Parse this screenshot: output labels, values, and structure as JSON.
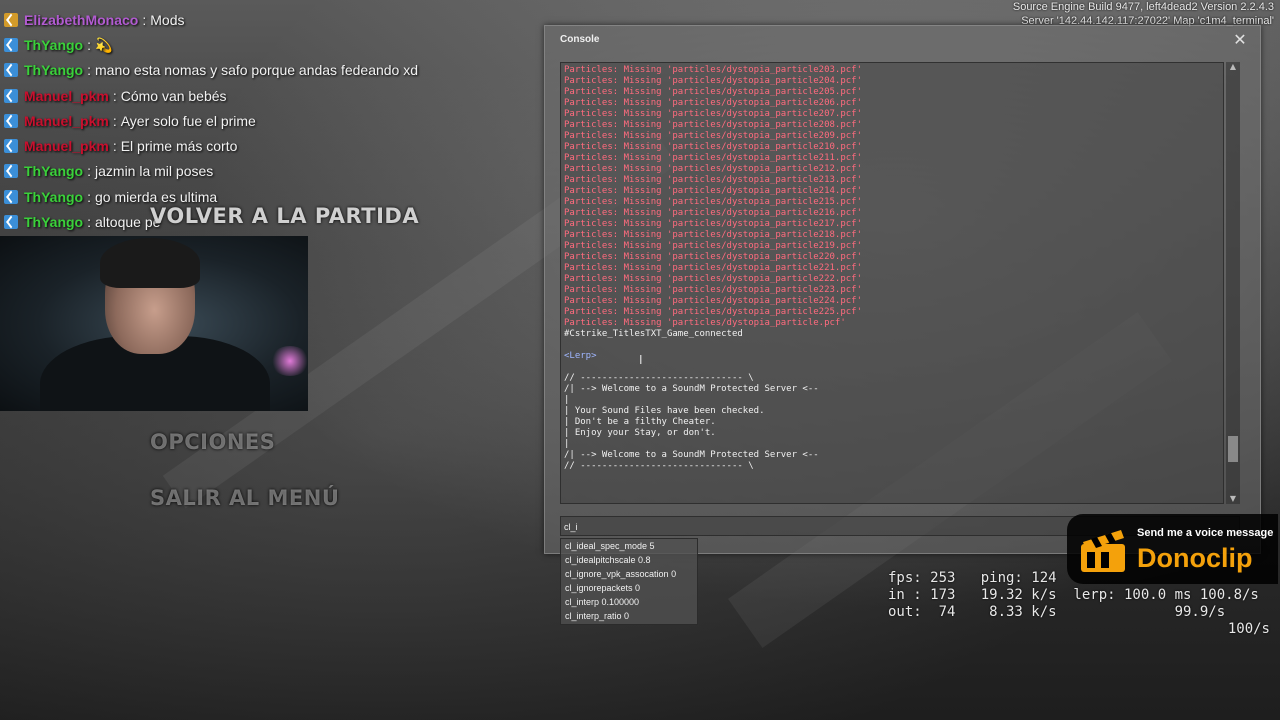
{
  "build_info": {
    "line1": "Source Engine Build 9477, left4dead2 Version 2.2.4.3",
    "line2": "Server '142.44.142.117:27022' Map 'c1m4_terminal'"
  },
  "chat": [
    {
      "user": "ElizabethMonaco",
      "message": "Mods",
      "user_color": "#b25bd1",
      "badge": "gold"
    },
    {
      "user": "ThYango",
      "message": "💫",
      "user_color": "#3ad13a",
      "badge": "blue"
    },
    {
      "user": "ThYango",
      "message": "mano esta nomas y safo porque andas fedeando xd",
      "user_color": "#3ad13a",
      "badge": "blue"
    },
    {
      "user": "Manuel_pkm",
      "message": "Cómo van bebés",
      "user_color": "#c8102e",
      "badge": "blue"
    },
    {
      "user": "Manuel_pkm",
      "message": "Ayer solo fue el prime",
      "user_color": "#c8102e",
      "badge": "blue"
    },
    {
      "user": "Manuel_pkm",
      "message": "El prime más corto",
      "user_color": "#c8102e",
      "badge": "blue"
    },
    {
      "user": "ThYango",
      "message": "jazmin la mil poses",
      "user_color": "#3ad13a",
      "badge": "blue"
    },
    {
      "user": "ThYango",
      "message": "go mierda es ultima",
      "user_color": "#3ad13a",
      "badge": "blue"
    },
    {
      "user": "ThYango",
      "message": "altoque pe",
      "user_color": "#3ad13a",
      "badge": "blue"
    }
  ],
  "menu": {
    "resume": "VOLVER A LA PARTIDA",
    "options": "OPCIONES",
    "quit": "SALIR AL MENÚ"
  },
  "console": {
    "title": "Console",
    "close": "✕",
    "log": [
      {
        "text": "Particles: Missing 'particles/dystopia_particle203.pcf'",
        "color": "red"
      },
      {
        "text": "Particles: Missing 'particles/dystopia_particle204.pcf'",
        "color": "red"
      },
      {
        "text": "Particles: Missing 'particles/dystopia_particle205.pcf'",
        "color": "red"
      },
      {
        "text": "Particles: Missing 'particles/dystopia_particle206.pcf'",
        "color": "red"
      },
      {
        "text": "Particles: Missing 'particles/dystopia_particle207.pcf'",
        "color": "red"
      },
      {
        "text": "Particles: Missing 'particles/dystopia_particle208.pcf'",
        "color": "red"
      },
      {
        "text": "Particles: Missing 'particles/dystopia_particle209.pcf'",
        "color": "red"
      },
      {
        "text": "Particles: Missing 'particles/dystopia_particle210.pcf'",
        "color": "red"
      },
      {
        "text": "Particles: Missing 'particles/dystopia_particle211.pcf'",
        "color": "red"
      },
      {
        "text": "Particles: Missing 'particles/dystopia_particle212.pcf'",
        "color": "red"
      },
      {
        "text": "Particles: Missing 'particles/dystopia_particle213.pcf'",
        "color": "red"
      },
      {
        "text": "Particles: Missing 'particles/dystopia_particle214.pcf'",
        "color": "red"
      },
      {
        "text": "Particles: Missing 'particles/dystopia_particle215.pcf'",
        "color": "red"
      },
      {
        "text": "Particles: Missing 'particles/dystopia_particle216.pcf'",
        "color": "red"
      },
      {
        "text": "Particles: Missing 'particles/dystopia_particle217.pcf'",
        "color": "red"
      },
      {
        "text": "Particles: Missing 'particles/dystopia_particle218.pcf'",
        "color": "red"
      },
      {
        "text": "Particles: Missing 'particles/dystopia_particle219.pcf'",
        "color": "red"
      },
      {
        "text": "Particles: Missing 'particles/dystopia_particle220.pcf'",
        "color": "red"
      },
      {
        "text": "Particles: Missing 'particles/dystopia_particle221.pcf'",
        "color": "red"
      },
      {
        "text": "Particles: Missing 'particles/dystopia_particle222.pcf'",
        "color": "red"
      },
      {
        "text": "Particles: Missing 'particles/dystopia_particle223.pcf'",
        "color": "red"
      },
      {
        "text": "Particles: Missing 'particles/dystopia_particle224.pcf'",
        "color": "red"
      },
      {
        "text": "Particles: Missing 'particles/dystopia_particle225.pcf'",
        "color": "red"
      },
      {
        "text": "Particles: Missing 'particles/dystopia_particle.pcf'",
        "color": "red"
      },
      {
        "text": "#Cstrike_TitlesTXT_Game_connected",
        "color": "white"
      },
      {
        "text": "",
        "color": "white"
      },
      {
        "text": "<Lerp>",
        "color": "blue"
      },
      {
        "text": "",
        "color": "white"
      },
      {
        "text": "// ------------------------------ \\",
        "color": "white"
      },
      {
        "text": "/| --> Welcome to a SoundM Protected Server <--",
        "color": "white"
      },
      {
        "text": "|",
        "color": "white"
      },
      {
        "text": "| Your Sound Files have been checked.",
        "color": "white"
      },
      {
        "text": "| Don't be a filthy Cheater.",
        "color": "white"
      },
      {
        "text": "| Enjoy your Stay, or don't.",
        "color": "white"
      },
      {
        "text": "|",
        "color": "white"
      },
      {
        "text": "/| --> Welcome to a SoundM Protected Server <--",
        "color": "white"
      },
      {
        "text": "// ------------------------------ \\",
        "color": "white"
      }
    ],
    "input_value": "cl_i",
    "scroll_position": 0.92
  },
  "autocomplete": [
    "cl_ideal_spec_mode 5",
    "cl_idealpitchscale 0.8",
    "cl_ignore_vpk_assocation 0",
    "cl_ignorepackets 0",
    "cl_interp 0.100000",
    "cl_interp_ratio 0"
  ],
  "netgraph": {
    "row1": "fps: 253   ping: 124",
    "row2": "in : 173   19.32 k/s  lerp: 100.0 ms 100.8/s",
    "row3": "out:  74    8.33 k/s              99.9/s",
    "row4": "100/s"
  },
  "donoclip": {
    "tagline": "Send me a voice message",
    "brand": "Donoclip",
    "brand_color": "#f4a10b"
  }
}
